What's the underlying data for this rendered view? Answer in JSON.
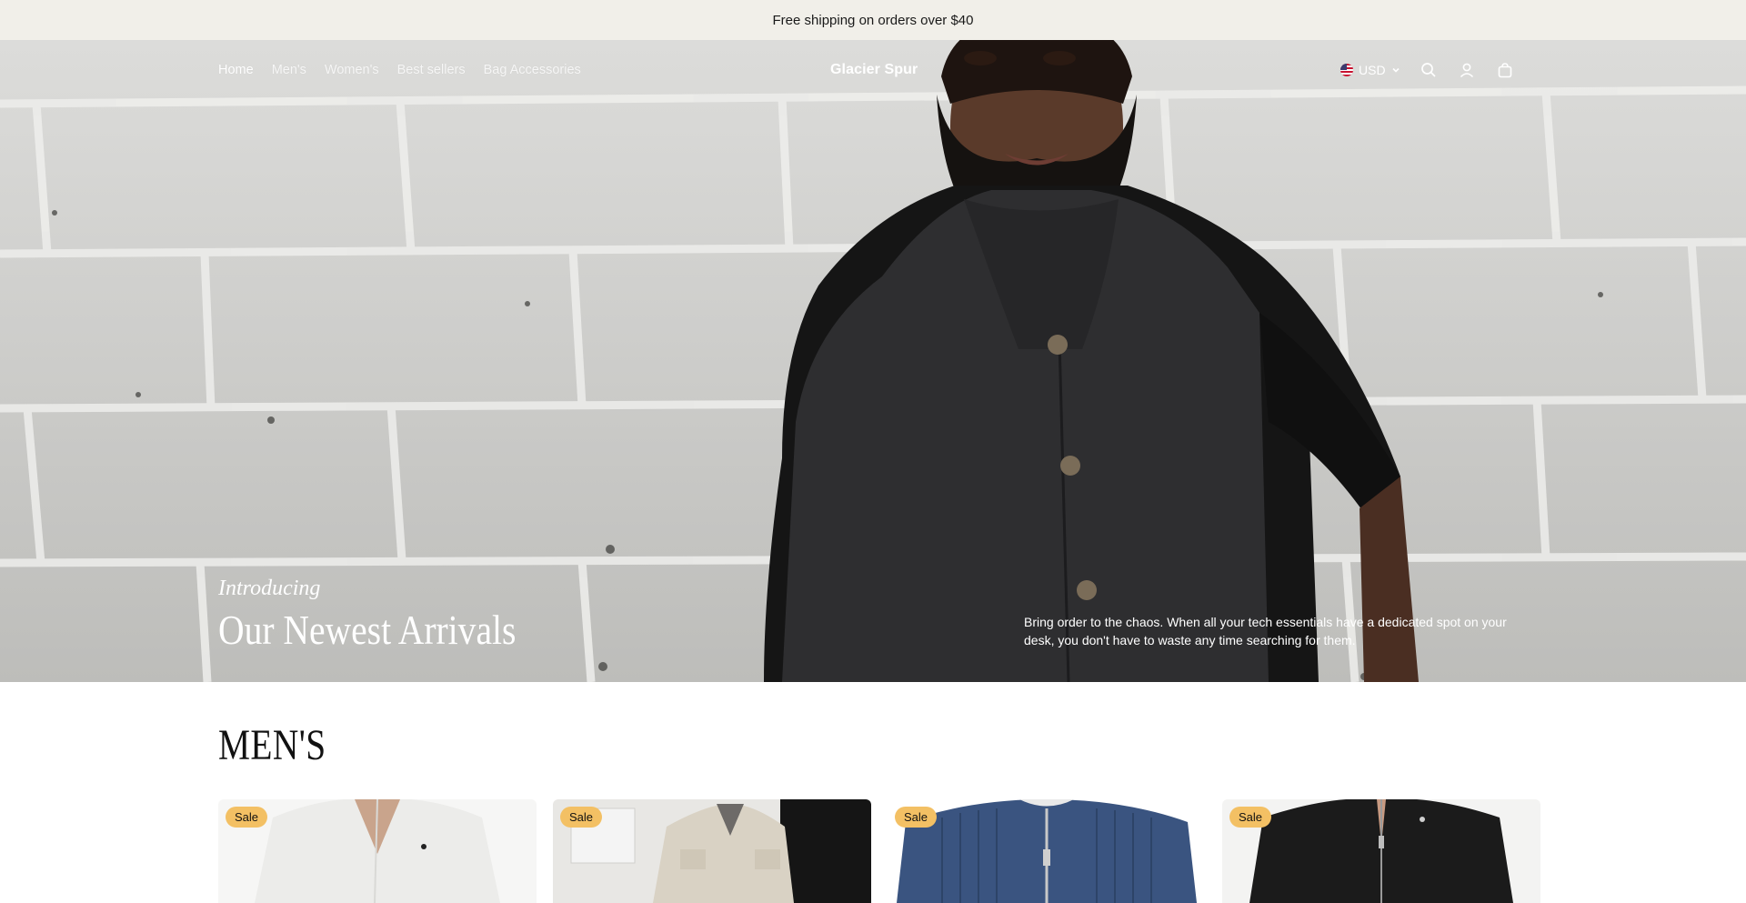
{
  "announcement": {
    "text": "Free shipping on orders over $40"
  },
  "header": {
    "nav": [
      {
        "label": "Home",
        "active": true
      },
      {
        "label": "Men's",
        "active": false
      },
      {
        "label": "Women's",
        "active": false
      },
      {
        "label": "Best sellers",
        "active": false
      },
      {
        "label": "Bag Accessories",
        "active": false
      }
    ],
    "logo": "Glacier Spur",
    "currency": {
      "label": "USD",
      "flag_icon": "us-flag-icon"
    },
    "icons": [
      "search-icon",
      "account-icon",
      "cart-icon"
    ]
  },
  "hero": {
    "eyebrow": "Introducing",
    "title": "Our Newest Arrivals",
    "description": "Bring order to the chaos. When all your tech essentials have a dedicated spot on your desk, you don't have to waste any time searching for them."
  },
  "section": {
    "title": "MEN'S",
    "products": [
      {
        "badge": "Sale"
      },
      {
        "badge": "Sale"
      },
      {
        "badge": "Sale"
      },
      {
        "badge": "Sale"
      }
    ]
  },
  "colors": {
    "announcement_bg": "#f1efe9",
    "sale_badge": "#f3c064",
    "text_dark": "#111111"
  }
}
